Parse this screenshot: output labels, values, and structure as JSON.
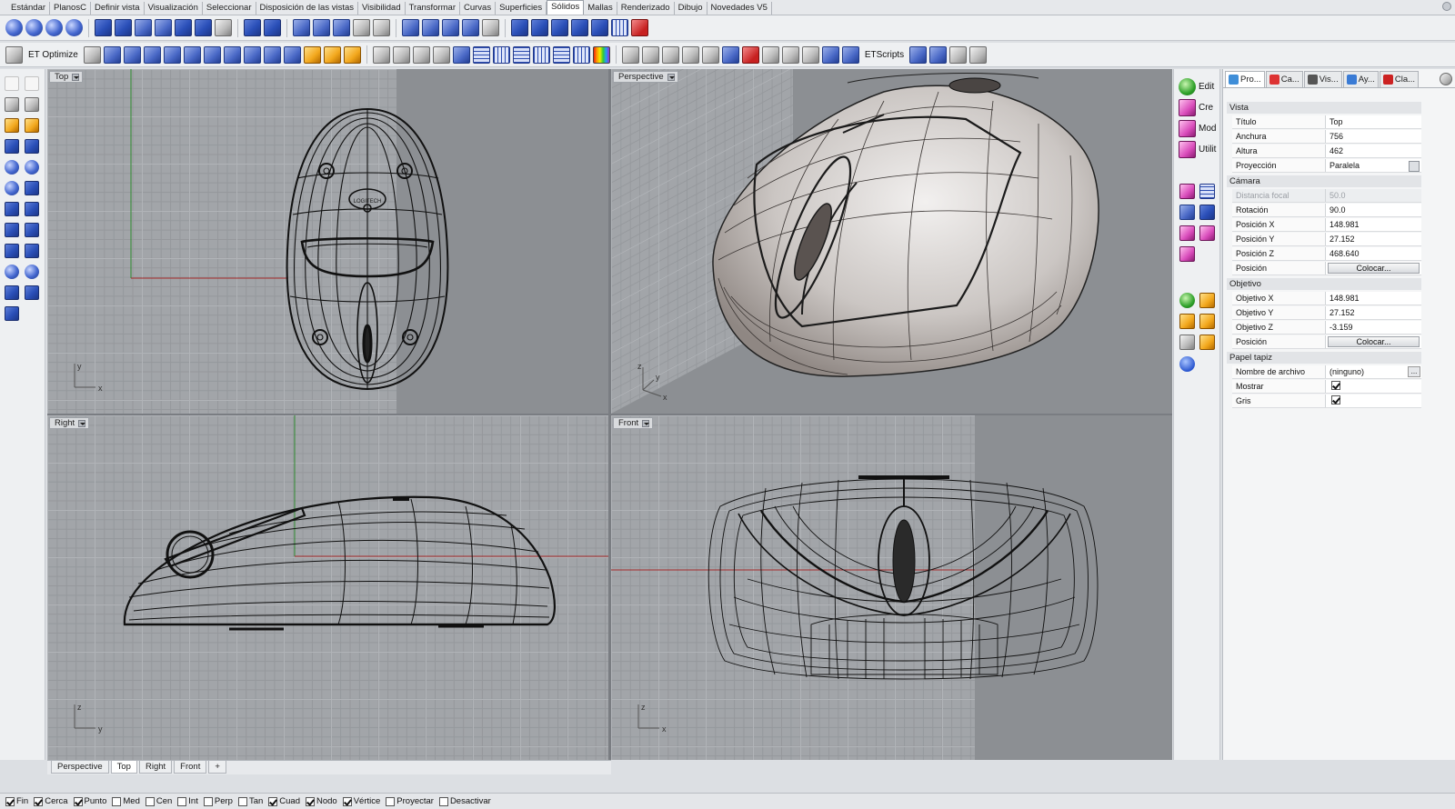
{
  "menu_tabs": [
    "Estándar",
    "PlanosC",
    "Definir vista",
    "Visualización",
    "Seleccionar",
    "Disposición de las vistas",
    "Visibilidad",
    "Transformar",
    "Curvas",
    "Superficies",
    "Sólidos",
    "Mallas",
    "Renderizado",
    "Dibujo",
    "Novedades V5"
  ],
  "active_tab": "Sólidos",
  "toolbar2": {
    "optimize_label": "ET Optimize",
    "scripts_label": "ETScripts"
  },
  "viewports": {
    "top": {
      "label": "Top",
      "axis_y": "y",
      "axis_x": "x",
      "logo": "LOGITECH"
    },
    "perspective": {
      "label": "Perspective",
      "axis_z": "z",
      "axis_y": "y",
      "axis_x": "x"
    },
    "right": {
      "label": "Right",
      "axis_z": "z",
      "axis_y": "y"
    },
    "front": {
      "label": "Front",
      "axis_z": "z",
      "axis_x": "x"
    }
  },
  "viewport_tabs": [
    "Perspective",
    "Top",
    "Right",
    "Front",
    "+"
  ],
  "active_viewport_tab": "Top",
  "right_mini": {
    "edit": "Edit",
    "create": "Cre",
    "modify": "Mod",
    "util": "Utilit"
  },
  "props_tabs": [
    "Pro...",
    "Ca...",
    "Vis...",
    "Ay...",
    "Cla..."
  ],
  "props": {
    "vista_header": "Vista",
    "titulo_k": "Título",
    "titulo_v": "Top",
    "anchura_k": "Anchura",
    "anchura_v": "756",
    "altura_k": "Altura",
    "altura_v": "462",
    "proyeccion_k": "Proyección",
    "proyeccion_v": "Paralela",
    "camara_header": "Cámara",
    "focal_k": "Distancia focal",
    "focal_v": "50.0",
    "rotacion_k": "Rotación",
    "rotacion_v": "90.0",
    "posx_k": "Posición X",
    "posx_v": "148.981",
    "posy_k": "Posición Y",
    "posy_v": "27.152",
    "posz_k": "Posición Z",
    "posz_v": "468.640",
    "pos_k": "Posición",
    "pos_btn": "Colocar...",
    "objetivo_header": "Objetivo",
    "objx_k": "Objetivo X",
    "objx_v": "148.981",
    "objy_k": "Objetivo Y",
    "objy_v": "27.152",
    "objz_k": "Objetivo Z",
    "objz_v": "-3.159",
    "objpos_k": "Posición",
    "objpos_btn": "Colocar...",
    "papel_header": "Papel tapiz",
    "archivo_k": "Nombre de archivo",
    "archivo_v": "(ninguno)",
    "mostrar_k": "Mostrar",
    "gris_k": "Gris"
  },
  "osnaps": [
    {
      "label": "Fin",
      "checked": true
    },
    {
      "label": "Cerca",
      "checked": true
    },
    {
      "label": "Punto",
      "checked": true
    },
    {
      "label": "Med",
      "checked": false
    },
    {
      "label": "Cen",
      "checked": false
    },
    {
      "label": "Int",
      "checked": false
    },
    {
      "label": "Perp",
      "checked": false
    },
    {
      "label": "Tan",
      "checked": false
    },
    {
      "label": "Cuad",
      "checked": true
    },
    {
      "label": "Nodo",
      "checked": true
    },
    {
      "label": "Vértice",
      "checked": true
    },
    {
      "label": "Proyectar",
      "checked": false
    },
    {
      "label": "Desactivar",
      "checked": false
    }
  ]
}
